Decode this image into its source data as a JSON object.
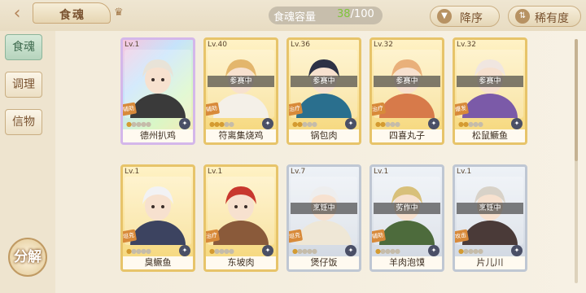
{
  "header": {
    "title": "食魂",
    "capacity_label": "食魂容量",
    "capacity_current": "38",
    "capacity_total": "/100",
    "sort_order_label": "降序",
    "sort_rarity_label": "稀有度"
  },
  "sidebar": {
    "items": [
      {
        "label": "食魂"
      },
      {
        "label": "调理"
      },
      {
        "label": "信物"
      }
    ],
    "decompose_label": "分解"
  },
  "cards": [
    {
      "level": "Lv.1",
      "name": "德州扒鸡",
      "status": "",
      "role": "辅助",
      "style": "rainbow",
      "stars": 1
    },
    {
      "level": "Lv.40",
      "name": "符离集烧鸡",
      "status": "参赛中",
      "role": "辅助",
      "style": "gold",
      "stars": 3
    },
    {
      "level": "Lv.36",
      "name": "锅包肉",
      "status": "参赛中",
      "role": "治疗",
      "style": "gold",
      "stars": 2
    },
    {
      "level": "Lv.32",
      "name": "四喜丸子",
      "status": "参赛中",
      "role": "治疗",
      "style": "gold",
      "stars": 2
    },
    {
      "level": "Lv.32",
      "name": "松鼠鳜鱼",
      "status": "参赛中",
      "role": "爆发",
      "style": "gold",
      "stars": 2
    },
    {
      "level": "Lv.1",
      "name": "臭鳜鱼",
      "status": "",
      "role": "坦克",
      "style": "gold",
      "stars": 1
    },
    {
      "level": "Lv.1",
      "name": "东坡肉",
      "status": "",
      "role": "治疗",
      "style": "gold",
      "stars": 1
    },
    {
      "level": "Lv.7",
      "name": "煲仔饭",
      "status": "烹饪中",
      "role": "坦克",
      "style": "silver",
      "stars": 1
    },
    {
      "level": "Lv.1",
      "name": "羊肉泡馍",
      "status": "劳作中",
      "role": "辅助",
      "style": "silver",
      "stars": 1
    },
    {
      "level": "Lv.1",
      "name": "片儿川",
      "status": "烹饪中",
      "role": "攻击",
      "style": "silver",
      "stars": 1
    }
  ],
  "colors": {
    "accent_green": "#7fc43b",
    "card_gold": "#e7c46a",
    "card_silver": "#bfc7d3",
    "text_brown": "#7a5330"
  }
}
